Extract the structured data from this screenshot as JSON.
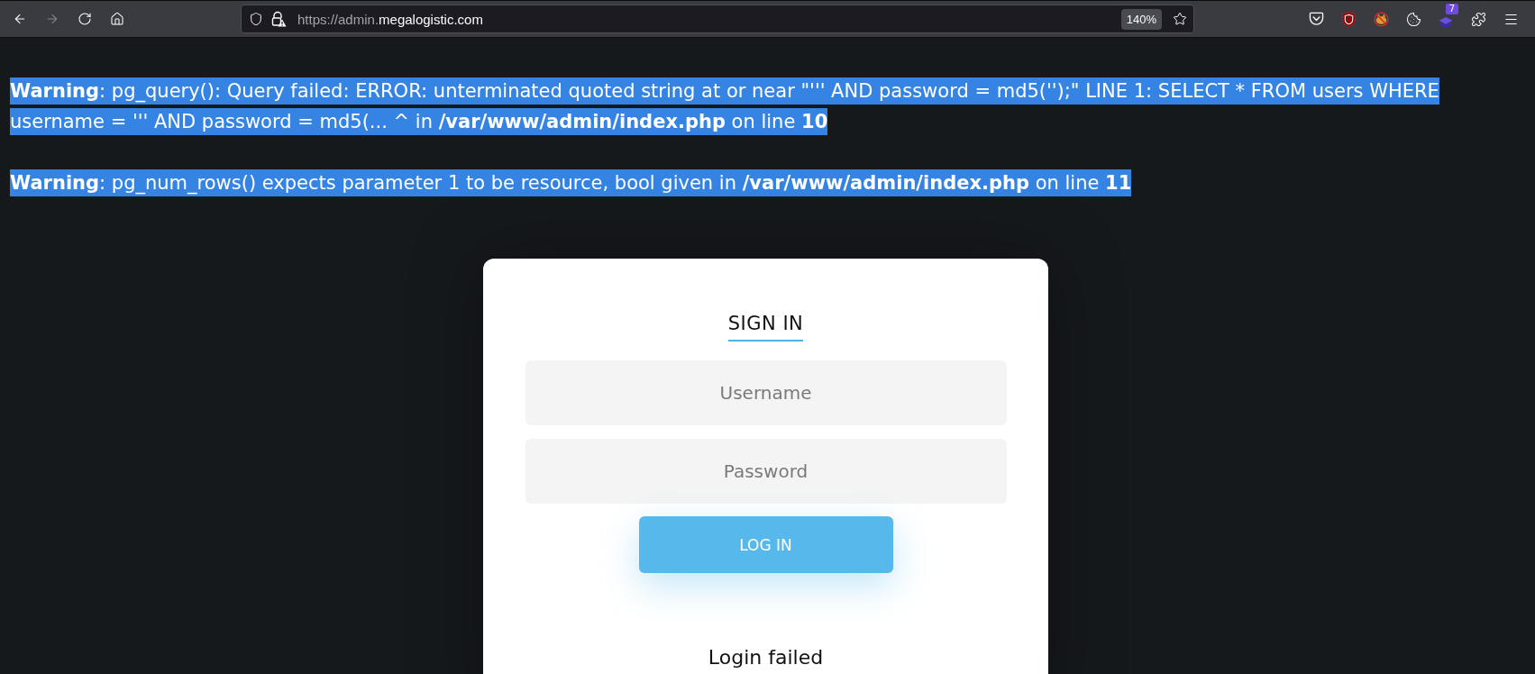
{
  "browser": {
    "nav_buttons": [
      {
        "kind": "back",
        "disabled": false
      },
      {
        "kind": "forward",
        "disabled": true
      },
      {
        "kind": "reload",
        "disabled": false
      },
      {
        "kind": "home",
        "disabled": false
      }
    ],
    "address_bar": {
      "url_prefix": "https://admin.",
      "url_domain": "megalogistic.com",
      "zoom": "140%"
    },
    "extensions_badge": "7"
  },
  "warnings": [
    {
      "selected": true,
      "text": "**Warning**: pg_query(): Query failed: ERROR: unterminated quoted string at or near \"''' AND password = md5('');\" LINE 1: SELECT * FROM users WHERE username = ''' AND password = md5(... ^ in **/var/www/admin/index.php** on line **10**"
    },
    {
      "selected": true,
      "text": "**Warning**: pg_num_rows() expects parameter 1 to be resource, bool given in **/var/www/admin/index.php** on line **11**"
    }
  ],
  "login": {
    "title": "SIGN IN",
    "fields": [
      {
        "placeholder": "Username"
      },
      {
        "placeholder": "Password"
      }
    ],
    "button": "LOG IN",
    "message": "Login failed"
  }
}
